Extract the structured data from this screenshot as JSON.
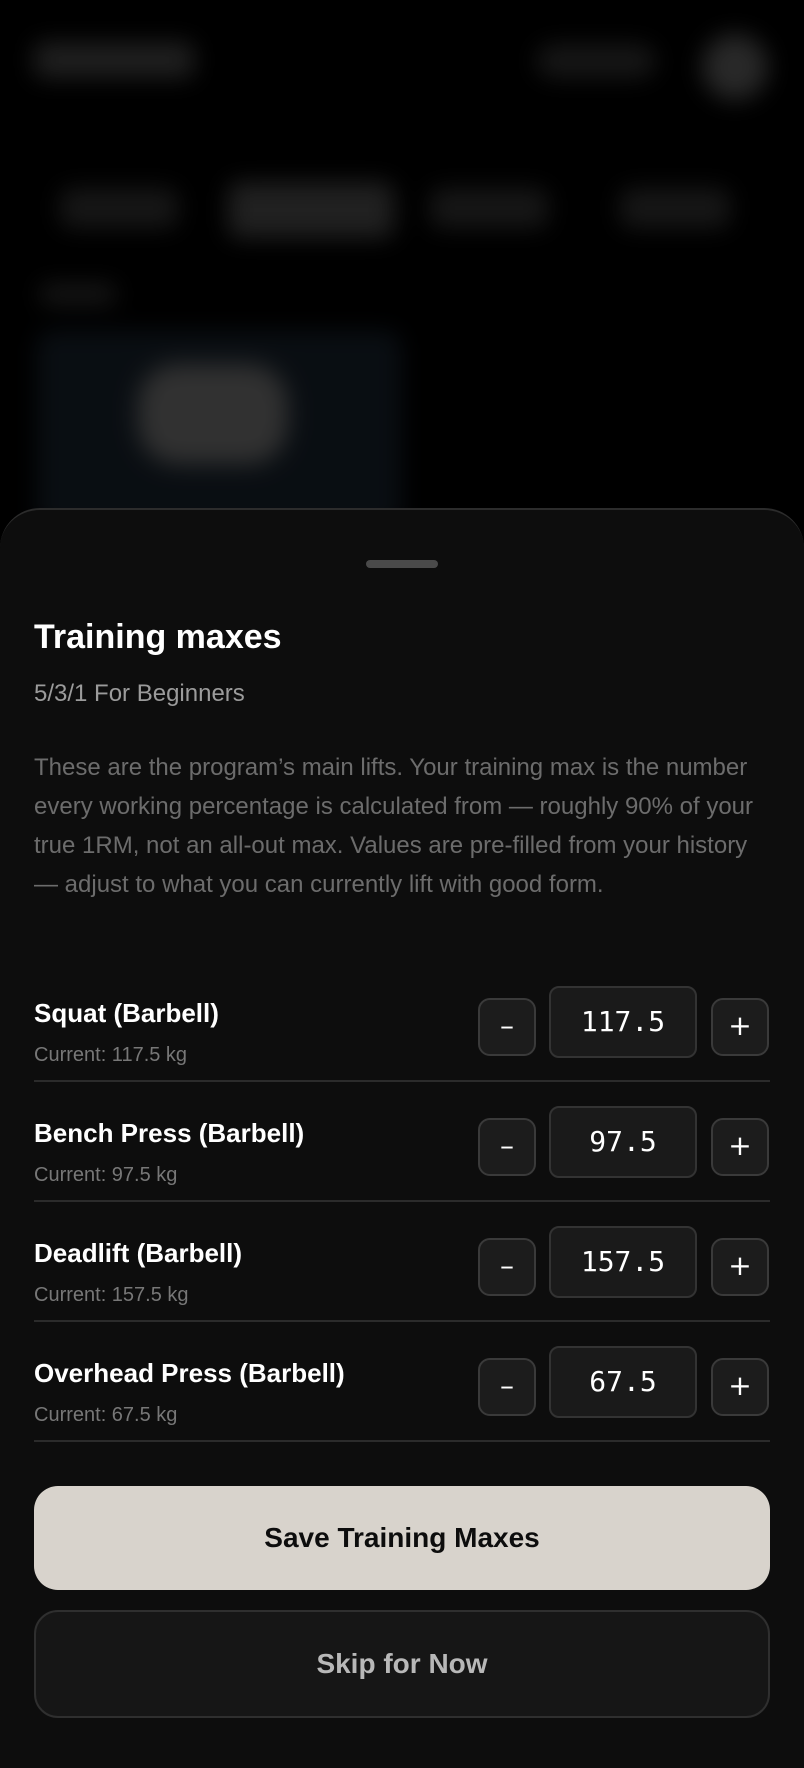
{
  "sheet": {
    "title": "Training maxes",
    "subtitle": "5/3/1 For Beginners",
    "description": "These are the program’s main lifts. Your training max is the number every working percentage is calculated from — roughly 90% of your true 1RM, not an all-out max. Values are pre-filled from your history — adjust to what you can currently lift with good form."
  },
  "lifts": [
    {
      "name": "Squat (Barbell)",
      "current": "Current: 117.5 kg",
      "value": "117.5"
    },
    {
      "name": "Bench Press (Barbell)",
      "current": "Current: 97.5 kg",
      "value": "97.5"
    },
    {
      "name": "Deadlift (Barbell)",
      "current": "Current: 157.5 kg",
      "value": "157.5"
    },
    {
      "name": "Overhead Press (Barbell)",
      "current": "Current: 67.5 kg",
      "value": "67.5"
    }
  ],
  "controls": {
    "decrement_label": "–",
    "increment_label": "+"
  },
  "actions": {
    "save_label": "Save Training Maxes",
    "skip_label": "Skip for Now"
  },
  "icons": {
    "decrement": "minus-icon",
    "increment": "plus-icon"
  }
}
